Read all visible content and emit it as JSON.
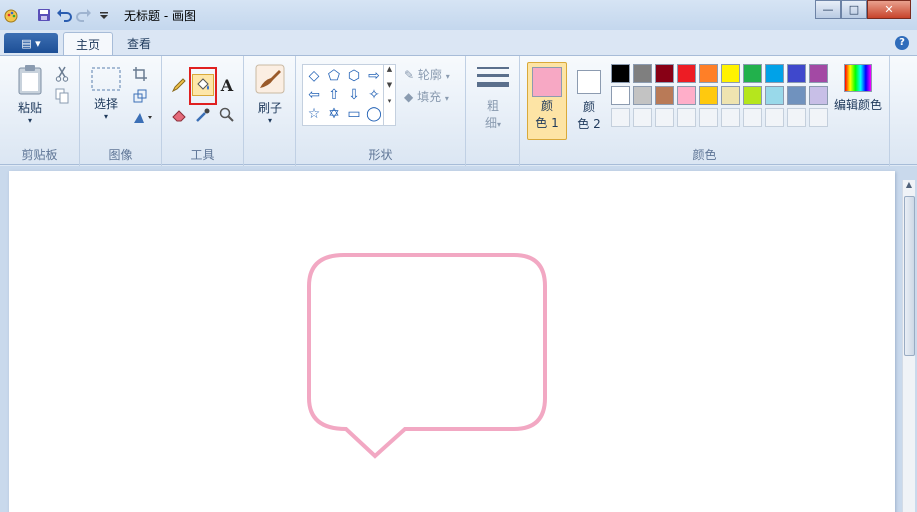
{
  "window": {
    "title": "无标题 - 画图"
  },
  "tabs": {
    "home": "主页",
    "view": "查看"
  },
  "ribbon": {
    "clipboard": {
      "paste": "粘贴",
      "label": "剪贴板"
    },
    "image": {
      "select": "选择",
      "label": "图像"
    },
    "tools": {
      "label": "工具"
    },
    "brushes": {
      "label": "刷子"
    },
    "shapes": {
      "outline": "轮廓",
      "fill": "填充",
      "label": "形状"
    },
    "size": {
      "line1": "粗",
      "line2": "细"
    },
    "colors": {
      "color1_line1": "颜",
      "color1_line2": "色 1",
      "color2_line1": "颜",
      "color2_line2": "色 2",
      "edit": "编辑颜色",
      "label": "颜色",
      "color1_value": "#f7a8c4",
      "color2_value": "#ffffff",
      "palette_row1": [
        "#000000",
        "#7f7f7f",
        "#880015",
        "#ed1c24",
        "#ff7f27",
        "#fff200",
        "#22b14c",
        "#00a2e8",
        "#3f48cc",
        "#a349a4"
      ],
      "palette_row2": [
        "#ffffff",
        "#c3c3c3",
        "#b97a57",
        "#ffaec9",
        "#ffc90e",
        "#efe4b0",
        "#b5e61d",
        "#99d9ea",
        "#7092be",
        "#c8bfe7"
      ]
    }
  },
  "canvas": {
    "shape": "speech-bubble",
    "stroke": "#f2a8c3"
  }
}
